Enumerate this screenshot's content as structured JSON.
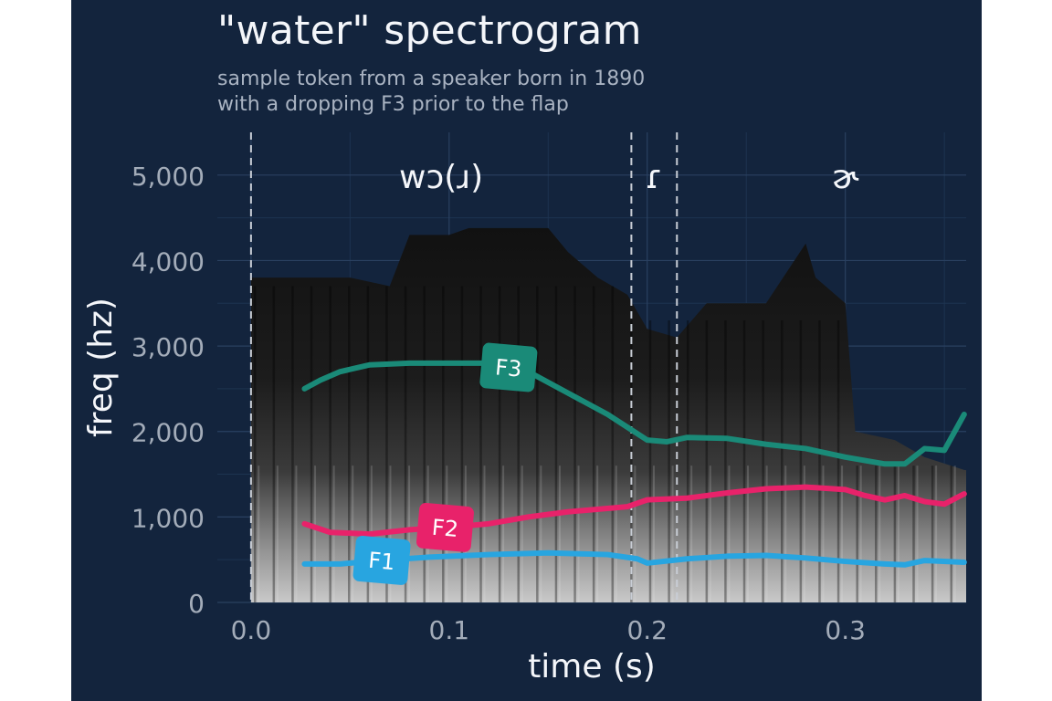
{
  "chart_data": {
    "type": "line",
    "title": "\"water\" spectrogram",
    "subtitle": [
      "sample token from a speaker born in 1890",
      "with a dropping F3 prior to the flap"
    ],
    "xlabel": "time (s)",
    "ylabel": "freq (hz)",
    "xlim": [
      -0.017,
      0.361
    ],
    "ylim": [
      0,
      5500
    ],
    "x_ticks": [
      0.0,
      0.1,
      0.2,
      0.3
    ],
    "x_tick_labels": [
      "0.0",
      "0.1",
      "0.2",
      "0.3"
    ],
    "y_ticks": [
      0,
      1000,
      2000,
      3000,
      4000,
      5000
    ],
    "y_tick_labels": [
      "0",
      "1,000",
      "2,000",
      "3,000",
      "4,000",
      "5,000"
    ],
    "grid": true,
    "background": "grayscale spectrogram",
    "segments": [
      {
        "label": "wɔ(ɹ)",
        "start": 0.0,
        "end": 0.192
      },
      {
        "label": "ɾ",
        "start": 0.192,
        "end": 0.215
      },
      {
        "label": "ɚ",
        "start": 0.215,
        "end": 0.385
      }
    ],
    "series": [
      {
        "name": "F3",
        "color": "#1a8a78",
        "label_at": 0.13,
        "x": [
          0.027,
          0.035,
          0.045,
          0.06,
          0.08,
          0.1,
          0.12,
          0.14,
          0.16,
          0.18,
          0.19,
          0.2,
          0.21,
          0.22,
          0.24,
          0.26,
          0.28,
          0.3,
          0.32,
          0.33,
          0.34,
          0.35,
          0.36
        ],
        "y": [
          2500,
          2600,
          2700,
          2780,
          2800,
          2800,
          2800,
          2700,
          2450,
          2200,
          2050,
          1900,
          1880,
          1930,
          1920,
          1850,
          1800,
          1700,
          1620,
          1620,
          1800,
          1780,
          2200
        ]
      },
      {
        "name": "F2",
        "color": "#e8226a",
        "label_at": 0.098,
        "x": [
          0.027,
          0.04,
          0.06,
          0.08,
          0.1,
          0.12,
          0.14,
          0.16,
          0.18,
          0.19,
          0.2,
          0.22,
          0.24,
          0.26,
          0.28,
          0.3,
          0.31,
          0.32,
          0.33,
          0.34,
          0.35,
          0.36
        ],
        "y": [
          920,
          820,
          800,
          850,
          880,
          920,
          1000,
          1060,
          1100,
          1120,
          1200,
          1220,
          1280,
          1330,
          1350,
          1320,
          1250,
          1200,
          1250,
          1180,
          1150,
          1270
        ]
      },
      {
        "name": "F1",
        "color": "#28a5e0",
        "label_at": 0.066,
        "x": [
          0.027,
          0.045,
          0.065,
          0.09,
          0.12,
          0.15,
          0.18,
          0.195,
          0.2,
          0.22,
          0.24,
          0.26,
          0.28,
          0.3,
          0.32,
          0.33,
          0.34,
          0.36
        ],
        "y": [
          450,
          450,
          490,
          530,
          560,
          580,
          560,
          510,
          460,
          510,
          540,
          550,
          520,
          480,
          450,
          440,
          490,
          470
        ]
      }
    ]
  }
}
